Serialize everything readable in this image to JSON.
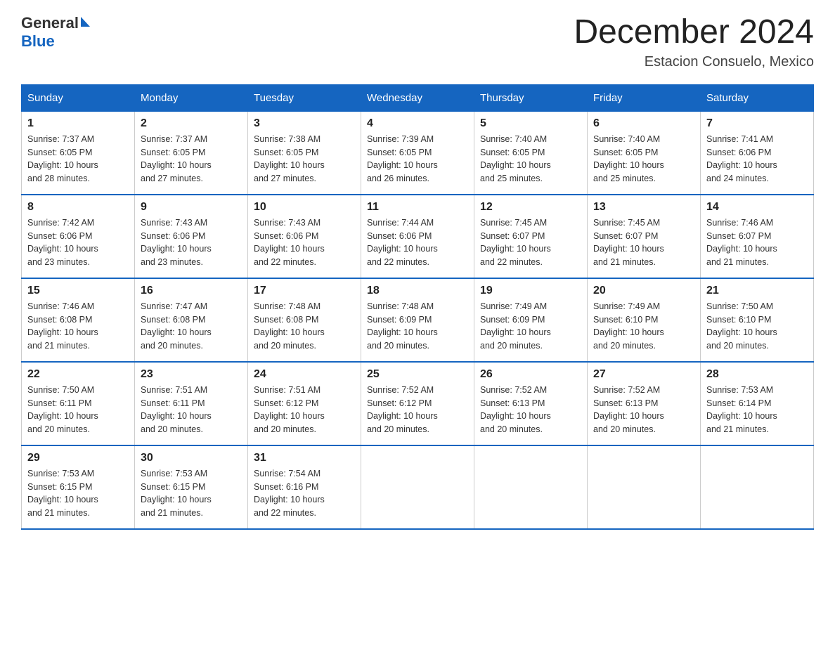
{
  "logo": {
    "general": "General",
    "blue": "Blue"
  },
  "title": "December 2024",
  "location": "Estacion Consuelo, Mexico",
  "days_of_week": [
    "Sunday",
    "Monday",
    "Tuesday",
    "Wednesday",
    "Thursday",
    "Friday",
    "Saturday"
  ],
  "weeks": [
    [
      {
        "day": "1",
        "sunrise": "7:37 AM",
        "sunset": "6:05 PM",
        "daylight": "10 hours and 28 minutes."
      },
      {
        "day": "2",
        "sunrise": "7:37 AM",
        "sunset": "6:05 PM",
        "daylight": "10 hours and 27 minutes."
      },
      {
        "day": "3",
        "sunrise": "7:38 AM",
        "sunset": "6:05 PM",
        "daylight": "10 hours and 27 minutes."
      },
      {
        "day": "4",
        "sunrise": "7:39 AM",
        "sunset": "6:05 PM",
        "daylight": "10 hours and 26 minutes."
      },
      {
        "day": "5",
        "sunrise": "7:40 AM",
        "sunset": "6:05 PM",
        "daylight": "10 hours and 25 minutes."
      },
      {
        "day": "6",
        "sunrise": "7:40 AM",
        "sunset": "6:05 PM",
        "daylight": "10 hours and 25 minutes."
      },
      {
        "day": "7",
        "sunrise": "7:41 AM",
        "sunset": "6:06 PM",
        "daylight": "10 hours and 24 minutes."
      }
    ],
    [
      {
        "day": "8",
        "sunrise": "7:42 AM",
        "sunset": "6:06 PM",
        "daylight": "10 hours and 23 minutes."
      },
      {
        "day": "9",
        "sunrise": "7:43 AM",
        "sunset": "6:06 PM",
        "daylight": "10 hours and 23 minutes."
      },
      {
        "day": "10",
        "sunrise": "7:43 AM",
        "sunset": "6:06 PM",
        "daylight": "10 hours and 22 minutes."
      },
      {
        "day": "11",
        "sunrise": "7:44 AM",
        "sunset": "6:06 PM",
        "daylight": "10 hours and 22 minutes."
      },
      {
        "day": "12",
        "sunrise": "7:45 AM",
        "sunset": "6:07 PM",
        "daylight": "10 hours and 22 minutes."
      },
      {
        "day": "13",
        "sunrise": "7:45 AM",
        "sunset": "6:07 PM",
        "daylight": "10 hours and 21 minutes."
      },
      {
        "day": "14",
        "sunrise": "7:46 AM",
        "sunset": "6:07 PM",
        "daylight": "10 hours and 21 minutes."
      }
    ],
    [
      {
        "day": "15",
        "sunrise": "7:46 AM",
        "sunset": "6:08 PM",
        "daylight": "10 hours and 21 minutes."
      },
      {
        "day": "16",
        "sunrise": "7:47 AM",
        "sunset": "6:08 PM",
        "daylight": "10 hours and 20 minutes."
      },
      {
        "day": "17",
        "sunrise": "7:48 AM",
        "sunset": "6:08 PM",
        "daylight": "10 hours and 20 minutes."
      },
      {
        "day": "18",
        "sunrise": "7:48 AM",
        "sunset": "6:09 PM",
        "daylight": "10 hours and 20 minutes."
      },
      {
        "day": "19",
        "sunrise": "7:49 AM",
        "sunset": "6:09 PM",
        "daylight": "10 hours and 20 minutes."
      },
      {
        "day": "20",
        "sunrise": "7:49 AM",
        "sunset": "6:10 PM",
        "daylight": "10 hours and 20 minutes."
      },
      {
        "day": "21",
        "sunrise": "7:50 AM",
        "sunset": "6:10 PM",
        "daylight": "10 hours and 20 minutes."
      }
    ],
    [
      {
        "day": "22",
        "sunrise": "7:50 AM",
        "sunset": "6:11 PM",
        "daylight": "10 hours and 20 minutes."
      },
      {
        "day": "23",
        "sunrise": "7:51 AM",
        "sunset": "6:11 PM",
        "daylight": "10 hours and 20 minutes."
      },
      {
        "day": "24",
        "sunrise": "7:51 AM",
        "sunset": "6:12 PM",
        "daylight": "10 hours and 20 minutes."
      },
      {
        "day": "25",
        "sunrise": "7:52 AM",
        "sunset": "6:12 PM",
        "daylight": "10 hours and 20 minutes."
      },
      {
        "day": "26",
        "sunrise": "7:52 AM",
        "sunset": "6:13 PM",
        "daylight": "10 hours and 20 minutes."
      },
      {
        "day": "27",
        "sunrise": "7:52 AM",
        "sunset": "6:13 PM",
        "daylight": "10 hours and 20 minutes."
      },
      {
        "day": "28",
        "sunrise": "7:53 AM",
        "sunset": "6:14 PM",
        "daylight": "10 hours and 21 minutes."
      }
    ],
    [
      {
        "day": "29",
        "sunrise": "7:53 AM",
        "sunset": "6:15 PM",
        "daylight": "10 hours and 21 minutes."
      },
      {
        "day": "30",
        "sunrise": "7:53 AM",
        "sunset": "6:15 PM",
        "daylight": "10 hours and 21 minutes."
      },
      {
        "day": "31",
        "sunrise": "7:54 AM",
        "sunset": "6:16 PM",
        "daylight": "10 hours and 22 minutes."
      },
      null,
      null,
      null,
      null
    ]
  ],
  "labels": {
    "sunrise": "Sunrise:",
    "sunset": "Sunset:",
    "daylight": "Daylight:"
  }
}
